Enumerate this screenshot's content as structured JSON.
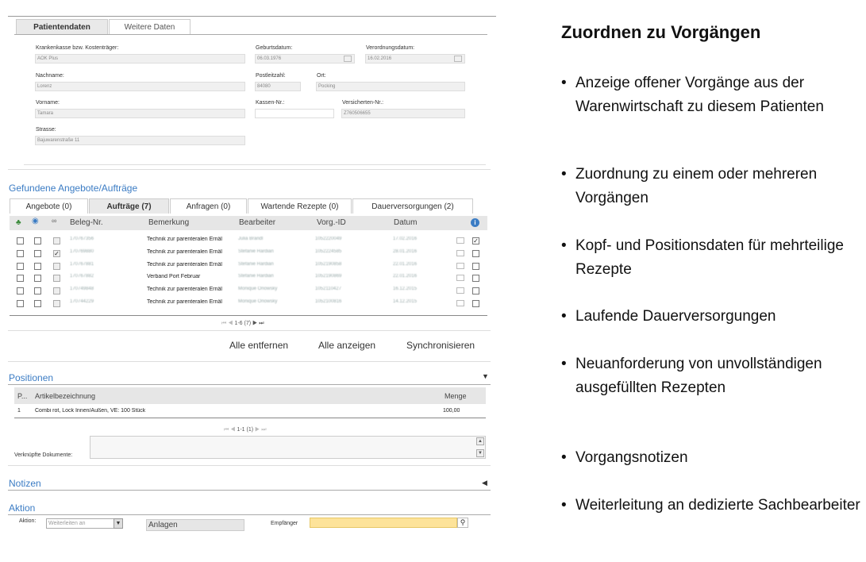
{
  "patient_tabs": [
    "Patientendaten",
    "Weitere Daten"
  ],
  "patient_fields": {
    "kasse": {
      "label": "Krankenkasse bzw. Kostenträger:",
      "value": "AOK Plus"
    },
    "geburt": {
      "label": "Geburtsdatum:",
      "value": "06.03.1976"
    },
    "verordnung": {
      "label": "Verordnungsdatum:",
      "value": "16.02.2016"
    },
    "nachname": {
      "label": "Nachname:",
      "value": "Lorenz"
    },
    "plz": {
      "label": "Postleitzahl:",
      "value": "84080"
    },
    "ort": {
      "label": "Ort:",
      "value": "Pocking"
    },
    "vorname": {
      "label": "Vorname:",
      "value": "Tamara"
    },
    "kassennr": {
      "label": "Kassen-Nr.:",
      "value": ""
    },
    "versnr": {
      "label": "Versicherten-Nr.:",
      "value": "Z760506655"
    },
    "strasse": {
      "label": "Strasse:",
      "value": "Bajuwarenstraße 11"
    }
  },
  "found_section": {
    "title": "Gefundene Angebote/Aufträge",
    "tabs": [
      "Angebote (0)",
      "Aufträge (7)",
      "Anfragen (0)",
      "Wartende Rezepte (0)",
      "Dauerversorgungen (2)"
    ]
  },
  "orders_table": {
    "headers": [
      "Beleg-Nr.",
      "Bemerkung",
      "Bearbeiter",
      "Vorg.-ID",
      "Datum"
    ],
    "rows": [
      {
        "beleg": "170767356",
        "bemerkung": "Technik zur parenteralen Ernäl",
        "bearbeiter": "Julia Brandl",
        "vorg": "1052220049",
        "datum": "17.02.2016",
        "c2": false,
        "c3": false,
        "c4": true
      },
      {
        "beleg": "170769880",
        "bemerkung": "Technik zur parenteralen Ernäl",
        "bearbeiter": "Stefanie Hardian",
        "vorg": "1052224585",
        "datum": "28.01.2016",
        "c2": false,
        "c3": true,
        "c4": false
      },
      {
        "beleg": "170767881",
        "bemerkung": "Technik zur parenteralen Ernäl",
        "bearbeiter": "Stefanie Hardian",
        "vorg": "1052190858",
        "datum": "22.01.2016",
        "c2": false,
        "c3": false,
        "c4": false
      },
      {
        "beleg": "170767882",
        "bemerkung": "Verband Port Februar",
        "bearbeiter": "Stefanie Hardian",
        "vorg": "1052190869",
        "datum": "22.01.2016",
        "c2": false,
        "c3": false,
        "c4": false
      },
      {
        "beleg": "170749848",
        "bemerkung": "Technik zur parenteralen Ernäl",
        "bearbeiter": "Monique Onowsky",
        "vorg": "1052110427",
        "datum": "16.12.2015",
        "c2": false,
        "c3": false,
        "c4": false
      },
      {
        "beleg": "170744229",
        "bemerkung": "Technik zur parenteralen Ernäl",
        "bearbeiter": "Monique Onowsky",
        "vorg": "1052100816",
        "datum": "14.12.2015",
        "c2": false,
        "c3": false,
        "c4": false
      }
    ],
    "pager": "1-6 (7)"
  },
  "action_buttons": [
    "Alle entfernen",
    "Alle anzeigen",
    "Synchronisieren"
  ],
  "positions": {
    "title": "Positionen",
    "headers": [
      "P...",
      "Artikelbezeichnung",
      "Menge"
    ],
    "rows": [
      {
        "p": "1",
        "artikel": "Combi rot, Lock Innen/Außen, VE: 100 Stück",
        "menge": "100,00"
      }
    ],
    "pager": "1-1 (1)",
    "docs_label": "Verknüpfte Dokumente:"
  },
  "notizen": {
    "title": "Notizen"
  },
  "aktion": {
    "title": "Aktion",
    "label": "Aktion:",
    "select_value": "Weiterleiten an",
    "anlagen": "Anlagen",
    "empfaenger_label": "Empfänger"
  },
  "right_panel": {
    "title": "Zuordnen zu Vorgängen",
    "bullets": [
      "Anzeige offener Vorgänge aus der Warenwirtschaft zu diesem Patienten",
      "Zuordnung zu einem oder mehreren Vorgängen",
      "Kopf- und Positionsdaten für mehrteilige Rezepte",
      "Laufende Dauerversorgungen",
      "Neuanforderung von unvollständigen ausgefüllten Rezepten",
      "Vorgangsnotizen",
      "Weiterleitung an dedizierte Sachbearbeiter"
    ]
  },
  "colors": {
    "accent_blue": "#3b7cc4",
    "highlight_yellow": "#fde39a",
    "header_grey": "#e6e6e6"
  }
}
